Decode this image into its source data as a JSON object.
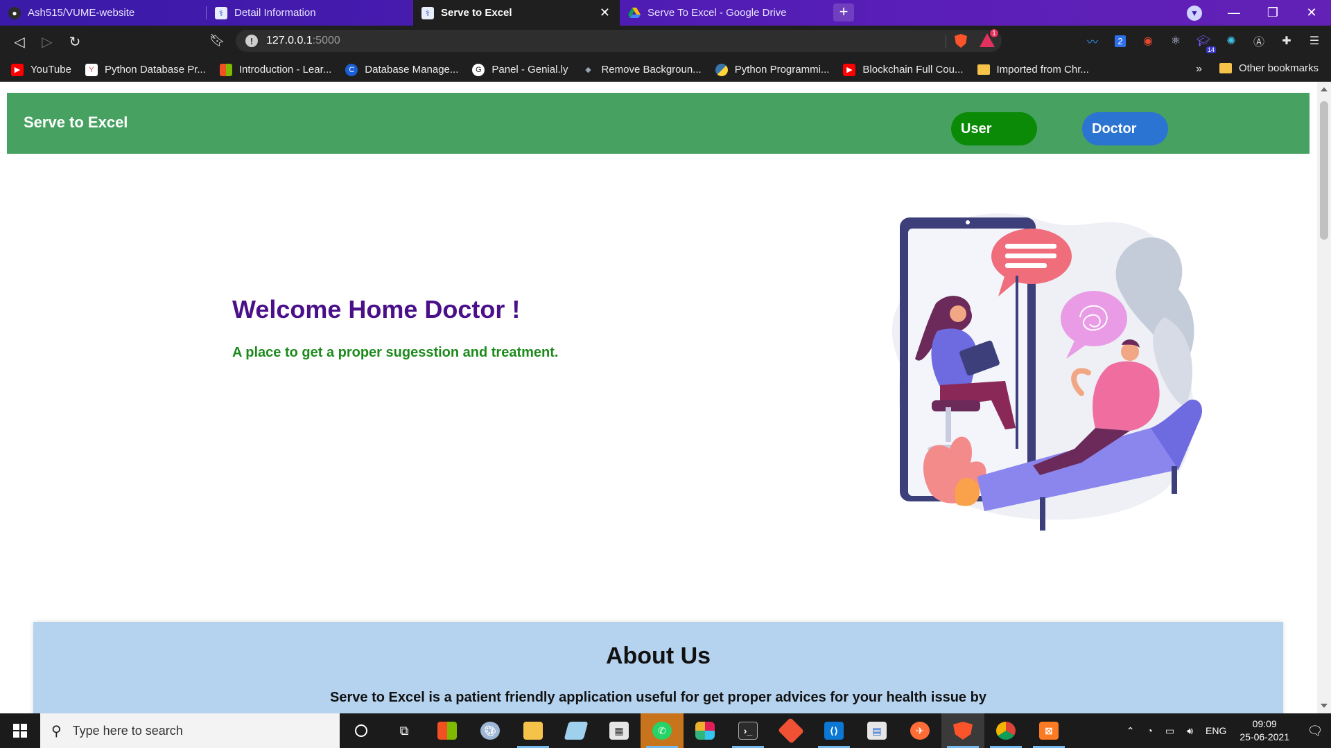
{
  "browser": {
    "tabs": [
      {
        "title": "Ash515/VUME-website",
        "icon": "github-icon",
        "active": false
      },
      {
        "title": "Detail Information",
        "icon": "serve-to-excel-favicon",
        "active": false
      },
      {
        "title": "Serve to Excel",
        "icon": "serve-to-excel-favicon",
        "active": true
      },
      {
        "title": "Serve To Excel - Google Drive",
        "icon": "google-drive-icon",
        "active": false
      }
    ],
    "new_tab_glyph": "+",
    "address": {
      "host": "127.0.0.1",
      "port": ":5000"
    },
    "rewards_badge": "1",
    "extension_badges": {
      "second": "2",
      "notification": "14"
    },
    "bookmarks": [
      {
        "label": "YouTube",
        "icon": "youtube-icon",
        "color": "#ff0000"
      },
      {
        "label": "Python Database Pr...",
        "icon": "bookmark-favicon",
        "color": "#d9534f"
      },
      {
        "label": "Introduction - Lear...",
        "icon": "microsoft-icon",
        "color": "#f25022"
      },
      {
        "label": "Database Manage...",
        "icon": "c-logo-icon",
        "color": "#1a5fd6"
      },
      {
        "label": "Panel - Genial.ly",
        "icon": "genially-icon",
        "color": "#ffffff"
      },
      {
        "label": "Remove Backgroun...",
        "icon": "layers-icon",
        "color": "#9aa3b5"
      },
      {
        "label": "Python Programmi...",
        "icon": "python-icon",
        "color": "#3776ab"
      },
      {
        "label": "Blockchain Full Cou...",
        "icon": "youtube-icon",
        "color": "#ff0000"
      },
      {
        "label": "Imported from Chr...",
        "icon": "folder-icon",
        "color": "#f6c34a"
      }
    ],
    "bookmarks_overflow": "»",
    "other_bookmarks": "Other bookmarks"
  },
  "page": {
    "brand": "Serve to Excel",
    "nav": {
      "user": "User",
      "doctor": "Doctor"
    },
    "hero": {
      "title": "Welcome Home Doctor !",
      "subtitle": "A place to get a proper sugesstion and treatment."
    },
    "about": {
      "title": "About Us",
      "text": "Serve to Excel is a patient friendly application useful for get proper advices for your health issue by"
    }
  },
  "taskbar": {
    "search_placeholder": "Type here to search",
    "language": "ENG",
    "time": "09:09",
    "date": "25-06-2021"
  },
  "colors": {
    "navbar": "#47a261",
    "user_pill": "#0a8a07",
    "doctor_pill": "#2b74d1",
    "hero_title": "#4a108a",
    "hero_subtitle": "#1b8a1b",
    "about_bg": "#b5d3ef"
  }
}
